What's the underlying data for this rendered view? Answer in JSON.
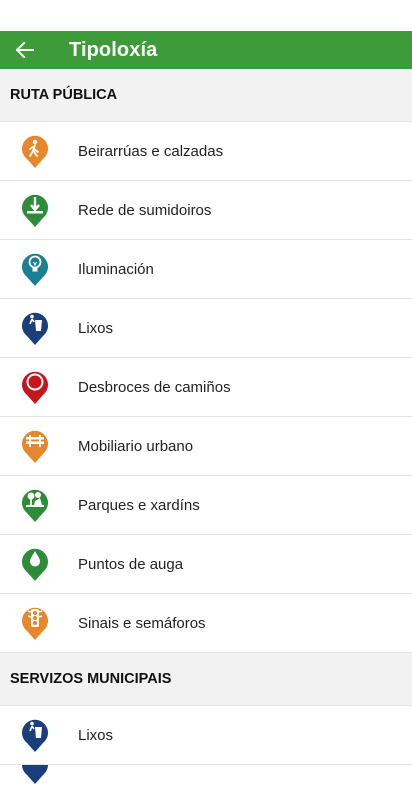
{
  "app_bar": {
    "title": "Tipoloxía",
    "color": "#3d9c39"
  },
  "sections": [
    {
      "header": "RUTA PÚBLICA",
      "items": [
        {
          "label": "Beirarrúas e calzadas",
          "icon": "pedestrian-icon",
          "color": "#e8862c"
        },
        {
          "label": "Rede de sumidoiros",
          "icon": "drain-icon",
          "color": "#2e8b3a"
        },
        {
          "label": "Iluminación",
          "icon": "lightbulb-icon",
          "color": "#1b7f93"
        },
        {
          "label": "Lixos",
          "icon": "trash-icon",
          "color": "#1a3f7a"
        },
        {
          "label": "Desbroces de camiños",
          "icon": "circle-icon",
          "color": "#c4161c"
        },
        {
          "label": "Mobiliario urbano",
          "icon": "bench-icon",
          "color": "#e8862c"
        },
        {
          "label": "Parques e xardíns",
          "icon": "park-icon",
          "color": "#2e8b3a"
        },
        {
          "label": "Puntos de auga",
          "icon": "water-drop-icon",
          "color": "#2e8b3a"
        },
        {
          "label": "Sinais e semáforos",
          "icon": "traffic-light-icon",
          "color": "#e8862c"
        }
      ]
    },
    {
      "header": "SERVIZOS MUNICIPAIS",
      "items": [
        {
          "label": "Lixos",
          "icon": "trash-icon",
          "color": "#1a3f7a"
        }
      ]
    }
  ]
}
